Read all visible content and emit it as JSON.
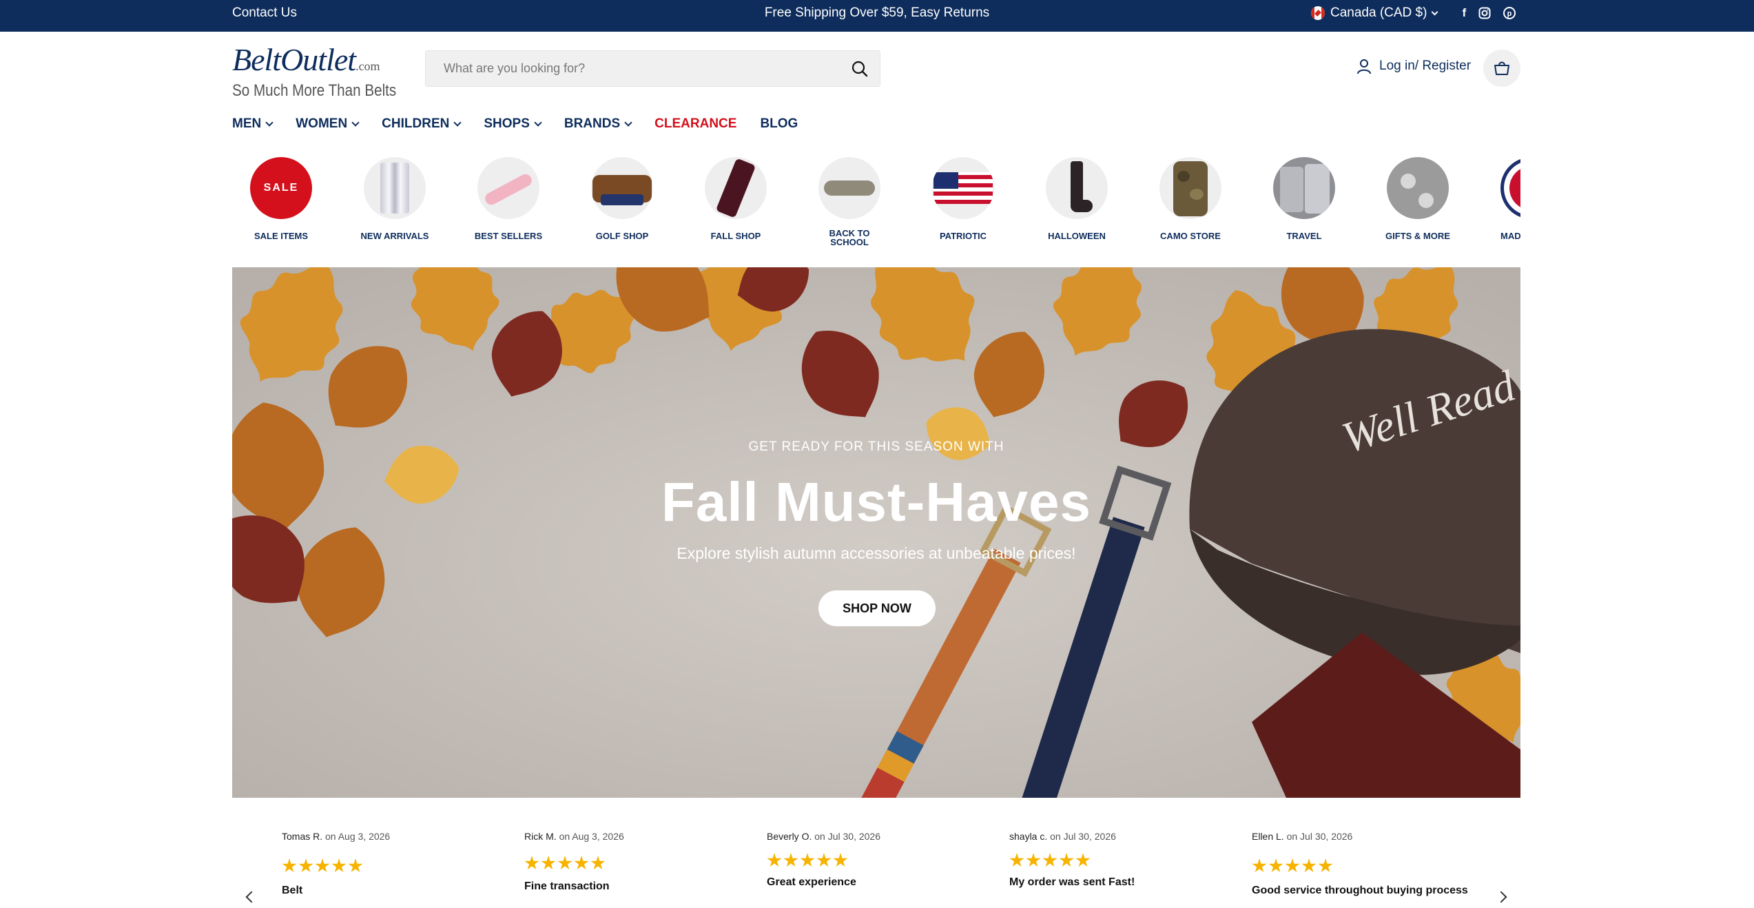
{
  "topbar": {
    "contact": "Contact Us",
    "promo": "Free Shipping Over $59, Easy Returns",
    "country": "Canada (CAD $)",
    "social": [
      "facebook-icon",
      "instagram-icon",
      "pinterest-icon"
    ]
  },
  "logo": {
    "name": "BeltOutlet",
    "suffix": ".com",
    "tagline": "So Much More Than Belts"
  },
  "search": {
    "placeholder": "What are you looking for?"
  },
  "account": {
    "label": "Log in/ Register"
  },
  "nav": [
    {
      "label": "MEN"
    },
    {
      "label": "WOMEN"
    },
    {
      "label": "CHILDREN"
    },
    {
      "label": "SHOPS"
    },
    {
      "label": "BRANDS"
    },
    {
      "label": "CLEARANCE"
    },
    {
      "label": "BLOG"
    }
  ],
  "categories": [
    {
      "label": "SALE ITEMS",
      "badge": "SALE"
    },
    {
      "label": "NEW ARRIVALS"
    },
    {
      "label": "BEST SELLERS"
    },
    {
      "label": "GOLF SHOP"
    },
    {
      "label": "FALL SHOP"
    },
    {
      "label": "BACK TO SCHOOL"
    },
    {
      "label": "PATRIOTIC"
    },
    {
      "label": "HALLOWEEN"
    },
    {
      "label": "CAMO STORE"
    },
    {
      "label": "TRAVEL"
    },
    {
      "label": "GIFTS & MORE"
    },
    {
      "label": "MADE IN USA"
    }
  ],
  "hero": {
    "eyebrow": "GET READY FOR THIS SEASON WITH",
    "title": "Fall Must-Haves",
    "subtitle": "Explore stylish autumn accessories at unbeatable prices!",
    "button": "SHOP NOW",
    "cap_text": "Well Read"
  },
  "reviews": [
    {
      "name": "Tomas R.",
      "date": "on Aug 3, 2026",
      "rating": 5,
      "title": "Belt"
    },
    {
      "name": "Rick M.",
      "date": "on Aug 3, 2026",
      "rating": 5,
      "title": "Fine transaction"
    },
    {
      "name": "Beverly O.",
      "date": "on Jul 30, 2026",
      "rating": 5,
      "title": "Great experience"
    },
    {
      "name": "shayla c.",
      "date": "on Jul 30, 2026",
      "rating": 5,
      "title": "My order was sent Fast!"
    },
    {
      "name": "Ellen L.",
      "date": "on Jul 30, 2026",
      "rating": 5,
      "title": "Good service throughout buying process"
    }
  ],
  "colors": {
    "brand_navy": "#0e2d5c",
    "clearance_red": "#d4101c",
    "star_gold": "#f6b400"
  }
}
